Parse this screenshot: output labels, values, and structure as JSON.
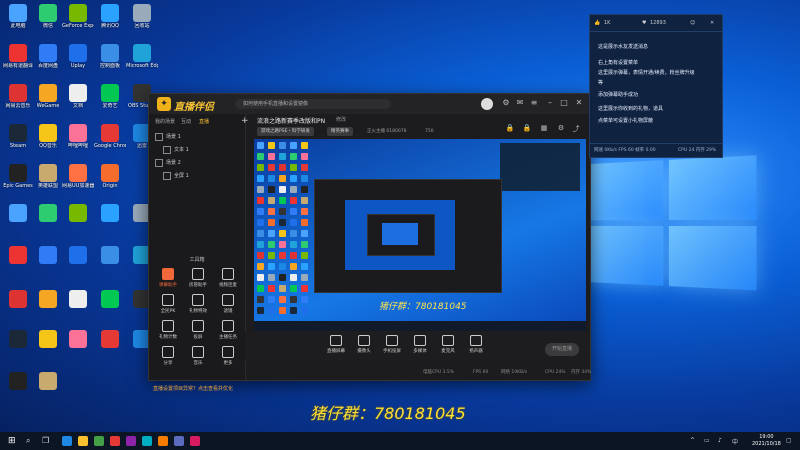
{
  "desktop_icons": [
    {
      "label": "此电脑",
      "color": "#4aa3ff"
    },
    {
      "label": "微信",
      "color": "#2ecc71"
    },
    {
      "label": "GeForce Experience",
      "color": "#76b900"
    },
    {
      "label": "腾讯QQ",
      "color": "#29a3ff"
    },
    {
      "label": "回收站",
      "color": "#9ab"
    },
    {
      "label": "网易有道翻译",
      "color": "#e33"
    },
    {
      "label": "百度网盘",
      "color": "#2f7cf6"
    },
    {
      "label": "Uplay",
      "color": "#1f6feb"
    },
    {
      "label": "控制面板",
      "color": "#3a8ee6"
    },
    {
      "label": "Microsoft Edge",
      "color": "#1fa3d8"
    },
    {
      "label": "网易云音乐",
      "color": "#d33"
    },
    {
      "label": "WeGame",
      "color": "#f5a623"
    },
    {
      "label": "文档",
      "color": "#eee"
    },
    {
      "label": "爱奇艺",
      "color": "#00c853"
    },
    {
      "label": "OBS Studio",
      "color": "#333"
    },
    {
      "label": "Steam",
      "color": "#1b2838"
    },
    {
      "label": "QQ音乐",
      "color": "#f5c518"
    },
    {
      "label": "哔哩哔哩",
      "color": "#fb7299"
    },
    {
      "label": "Google Chrome",
      "color": "#e53935"
    },
    {
      "label": "迅雷",
      "color": "#1e88e5"
    },
    {
      "label": "Epic Games",
      "color": "#222"
    },
    {
      "label": "英雄联盟",
      "color": "#c8aa6e"
    },
    {
      "label": "网易UU加速器",
      "color": "#ff7043"
    },
    {
      "label": "Origin",
      "color": "#f56c2d"
    }
  ],
  "app": {
    "brand": "直播伴侣",
    "notice": "如何使用手机直播和设置镜像",
    "tabs": [
      "我的场景",
      "互动",
      "直播",
      "添加"
    ],
    "scenes": [
      "场景 1",
      "文本 1",
      "场景 2",
      "全屏 1"
    ],
    "tools_title": "工具箱",
    "tools": [
      {
        "label": "弹幕助手",
        "hot": true
      },
      {
        "label": "房管助手",
        "hot": false
      },
      {
        "label": "视频连麦",
        "hot": false
      },
      {
        "label": "全民PK",
        "hot": false
      },
      {
        "label": "礼物特效",
        "hot": false
      },
      {
        "label": "滤镜",
        "hot": false
      },
      {
        "label": "礼物计数",
        "hot": false
      },
      {
        "label": "投屏",
        "hot": false
      },
      {
        "label": "主播任务",
        "hot": false
      },
      {
        "label": "分享",
        "hot": false
      },
      {
        "label": "音乐",
        "hot": false
      },
      {
        "label": "更多",
        "hot": false
      }
    ],
    "alert": "直播设置项目异常？点击查看并优化",
    "room_title": "流浪之路新赛季改版和PN",
    "modify": "修改",
    "chips": [
      "游戏之路PSE・科学研发",
      "精英赛事"
    ],
    "meta": [
      "正火主播  6180078",
      "750"
    ],
    "watermark_small": "猪仔群：780181045",
    "controls": [
      "直播屏幕",
      "摄像头",
      "手机投屏",
      "多媒体",
      "麦克风",
      "扬声器"
    ],
    "go_live": "开始直播",
    "status": [
      "电脑CPU 3.5%",
      "FPS 60",
      "网络 19KB/s",
      "CPU 24%",
      "内存 34%"
    ]
  },
  "panel": {
    "likes": "1K",
    "fans": "12893",
    "messages": [
      "这是展示水友发送消息",
      "右上角有设置菜单",
      "这里展示弹幕，表情开通/续费，粉丝牌升级",
      "等",
      "添加弹幕助手成功",
      "这里展示你收到的礼物，道具",
      "点菜单可设置小礼物屏蔽"
    ],
    "foot": [
      "网速 0Kb/s FPS 60 帧率 0.00",
      "CPU 24 内存 29%"
    ]
  },
  "watermark": "猪仔群：780181045",
  "taskbar": {
    "icons": [
      "#1e88e5",
      "#fbc02d",
      "#43a047",
      "#e53935",
      "#8e24aa",
      "#00acc1",
      "#f57c00",
      "#5c6bc0",
      "#d81b60"
    ],
    "time": "19:00",
    "date": "2021/10/18"
  }
}
